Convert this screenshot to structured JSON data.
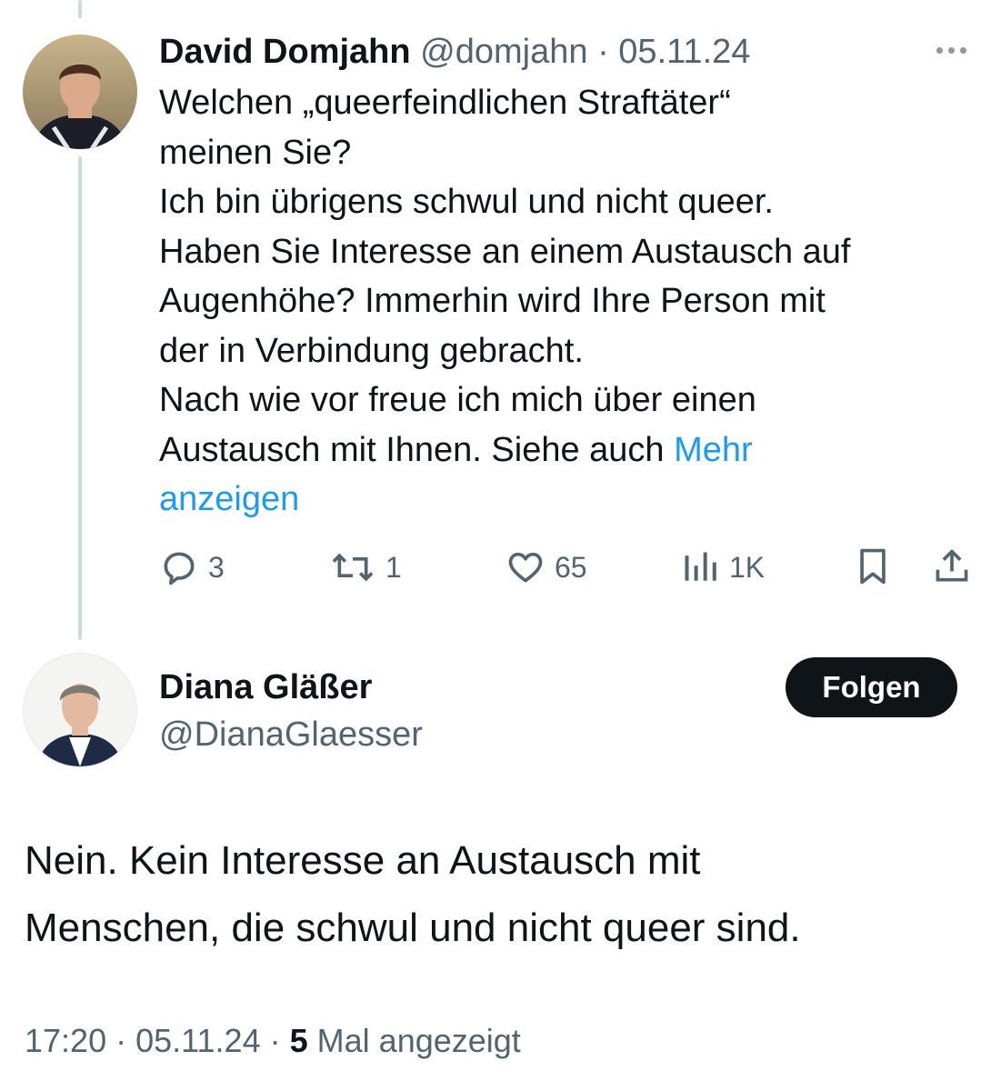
{
  "reply_tweet": {
    "author_name": "David Domjahn",
    "author_handle": "@domjahn",
    "separator": "·",
    "date": "05.11.24",
    "body_lines": [
      "Welchen „queerfeindlichen Straftäter“",
      "meinen Sie?",
      "Ich bin übrigens schwul und nicht queer.",
      "Haben Sie Interesse an einem Austausch auf",
      "Augenhöhe? Immerhin wird Ihre Person mit",
      "der in Verbindung gebracht.",
      "Nach wie vor freue ich mich über einen"
    ],
    "last_line_text": "Austausch mit Ihnen. Siehe auch ",
    "show_more_part1": "Mehr",
    "show_more_part2": "anzeigen",
    "more_icon": "more-horizontal-icon",
    "actions": {
      "reply": {
        "icon": "reply-icon",
        "count": "3"
      },
      "repost": {
        "icon": "repost-icon",
        "count": "1"
      },
      "like": {
        "icon": "heart-icon",
        "count": "65"
      },
      "views": {
        "icon": "views-icon",
        "count": "1K"
      },
      "bookmark": {
        "icon": "bookmark-icon"
      },
      "share": {
        "icon": "share-icon"
      }
    }
  },
  "main_tweet": {
    "author_name": "Diana Gläßer",
    "author_handle": "@DianaGlaesser",
    "follow_label": "Folgen",
    "body_lines": [
      "Nein. Kein Interesse an Austausch mit",
      "Menschen, die schwul und nicht queer sind."
    ],
    "time": "17:20",
    "separator": "·",
    "date": "05.11.24",
    "views_count": "5",
    "views_label": "Mal angezeigt"
  },
  "colors": {
    "text_primary": "#0f1419",
    "text_secondary": "#536471",
    "link": "#1d9bf0",
    "thread_line": "#cfd9de",
    "follow_button_bg": "#0f1419"
  }
}
